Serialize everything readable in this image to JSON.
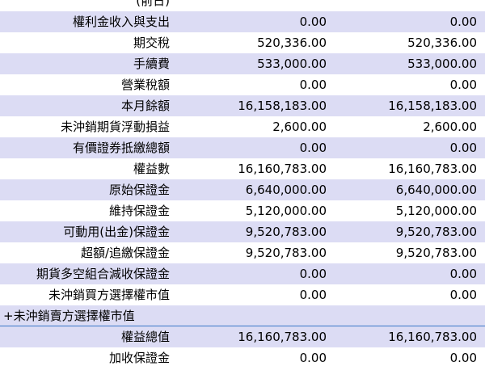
{
  "table": {
    "rows": [
      {
        "label": "(前日)",
        "amount": "",
        "amount2": "",
        "shade": "plain",
        "align": "right"
      },
      {
        "label": "權利金收入與支出",
        "amount": "0.00",
        "amount2": "0.00",
        "shade": "alt",
        "align": "right"
      },
      {
        "label": "期交稅",
        "amount": "520,336.00",
        "amount2": "520,336.00",
        "shade": "plain",
        "align": "right"
      },
      {
        "label": "手續費",
        "amount": "533,000.00",
        "amount2": "533,000.00",
        "shade": "alt",
        "align": "right"
      },
      {
        "label": "營業稅額",
        "amount": "0.00",
        "amount2": "0.00",
        "shade": "plain",
        "align": "right"
      },
      {
        "label": "本月餘額",
        "amount": "16,158,183.00",
        "amount2": "16,158,183.00",
        "shade": "alt",
        "align": "right"
      },
      {
        "label": "未沖銷期貨浮動損益",
        "amount": "2,600.00",
        "amount2": "2,600.00",
        "shade": "plain",
        "align": "right"
      },
      {
        "label": "有價證券抵繳總額",
        "amount": "0.00",
        "amount2": "0.00",
        "shade": "alt",
        "align": "right"
      },
      {
        "label": "權益數",
        "amount": "16,160,783.00",
        "amount2": "16,160,783.00",
        "shade": "plain",
        "align": "right"
      },
      {
        "label": "原始保證金",
        "amount": "6,640,000.00",
        "amount2": "6,640,000.00",
        "shade": "alt",
        "align": "right"
      },
      {
        "label": "維持保證金",
        "amount": "5,120,000.00",
        "amount2": "5,120,000.00",
        "shade": "plain",
        "align": "right"
      },
      {
        "label": "可動用(出金)保證金",
        "amount": "9,520,783.00",
        "amount2": "9,520,783.00",
        "shade": "alt",
        "align": "right"
      },
      {
        "label": "超額/追繳保證金",
        "amount": "9,520,783.00",
        "amount2": "9,520,783.00",
        "shade": "plain",
        "align": "right"
      },
      {
        "label": "期貨多空組合減收保證金",
        "amount": "0.00",
        "amount2": "0.00",
        "shade": "alt",
        "align": "right"
      },
      {
        "label": "未沖銷買方選擇權市值",
        "amount": "0.00",
        "amount2": "0.00",
        "shade": "plain",
        "align": "right"
      },
      {
        "label": "+未沖銷賣方選擇權市值",
        "amount": "",
        "amount2": "",
        "shade": "alt",
        "align": "left",
        "divider": true
      },
      {
        "label": "權益總值",
        "amount": "16,160,783.00",
        "amount2": "16,160,783.00",
        "shade": "alt",
        "align": "right"
      },
      {
        "label": "加收保證金",
        "amount": "0.00",
        "amount2": "0.00",
        "shade": "plain",
        "align": "right"
      }
    ]
  }
}
